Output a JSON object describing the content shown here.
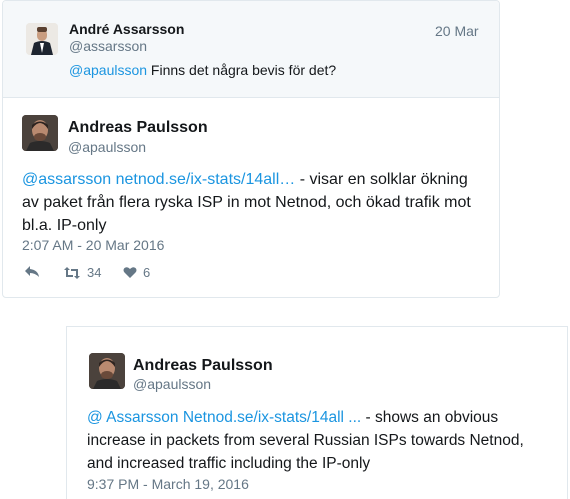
{
  "card1": {
    "reply": {
      "author_name": "André Assarsson",
      "author_handle": "@assarsson",
      "date": "20 Mar",
      "mention": "@apaulsson",
      "text": " Finns det några bevis för det?"
    },
    "main": {
      "author_name": "Andreas Paulsson",
      "author_handle": "@apaulsson",
      "mention": "@assarsson",
      "url": "netnod.se/ix-stats/14all…",
      "text_line1": " - visar en solklar ökning",
      "text_line2": "av paket från flera ryska ISP in mot Netnod, och ökad trafik mot",
      "text_line3": "bl.a. IP-only",
      "timestamp": "2:07 AM - 20 Mar 2016",
      "actions": {
        "reply_icon": "reply-icon",
        "retweet_icon": "retweet-icon",
        "retweet_count": "34",
        "like_icon": "heart-icon",
        "like_count": "6"
      }
    }
  },
  "card2": {
    "author_name": "Andreas Paulsson",
    "author_handle": "@apaulsson",
    "mention_line": "@ Assarsson Netnod.se/ix-stats/14all ...",
    "text_line1_rest": " - shows an obvious",
    "text_line2": "increase in packets from several Russian ISPs towards Netnod,",
    "text_line3": "and increased traffic including the IP-only",
    "timestamp": "9:37 PM - March 19, 2016"
  },
  "colors": {
    "link": "#1b95e0",
    "muted": "#657786",
    "border": "#e1e8ed",
    "reply_bg": "#f5f8fa"
  }
}
